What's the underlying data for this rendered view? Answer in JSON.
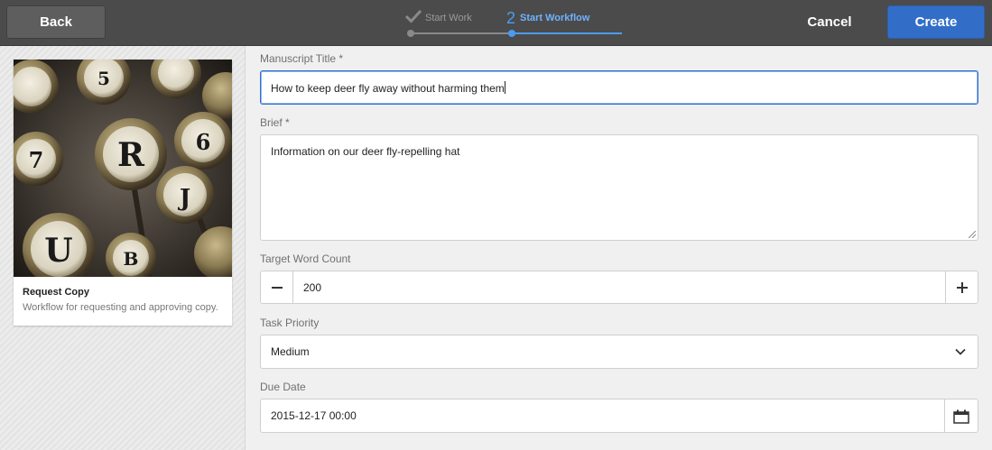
{
  "toolbar": {
    "back_label": "Back",
    "cancel_label": "Cancel",
    "create_label": "Create"
  },
  "wizard": {
    "steps": [
      {
        "label": "Start Work",
        "status": "done",
        "icon": "checkmark-icon"
      },
      {
        "number": "2",
        "label": "Start Workflow",
        "status": "active"
      }
    ],
    "colors": {
      "active": "#4b9cf0",
      "done": "#8a8a8a"
    }
  },
  "card": {
    "title": "Request Copy",
    "description": "Workflow for requesting and approving copy.",
    "image": "typewriter-keys-thumbnail"
  },
  "form": {
    "manuscript_title": {
      "label": "Manuscript Title *",
      "value": "How to keep deer fly away without harming them"
    },
    "brief": {
      "label": "Brief *",
      "value": "Information on our deer fly-repelling hat"
    },
    "target_word_count": {
      "label": "Target Word Count",
      "value": "200"
    },
    "task_priority": {
      "label": "Task Priority",
      "value": "Medium"
    },
    "due_date": {
      "label": "Due Date",
      "value": "2015-12-17 00:00"
    }
  },
  "colors": {
    "accent": "#326ec8",
    "topbar": "#4b4b4b"
  }
}
